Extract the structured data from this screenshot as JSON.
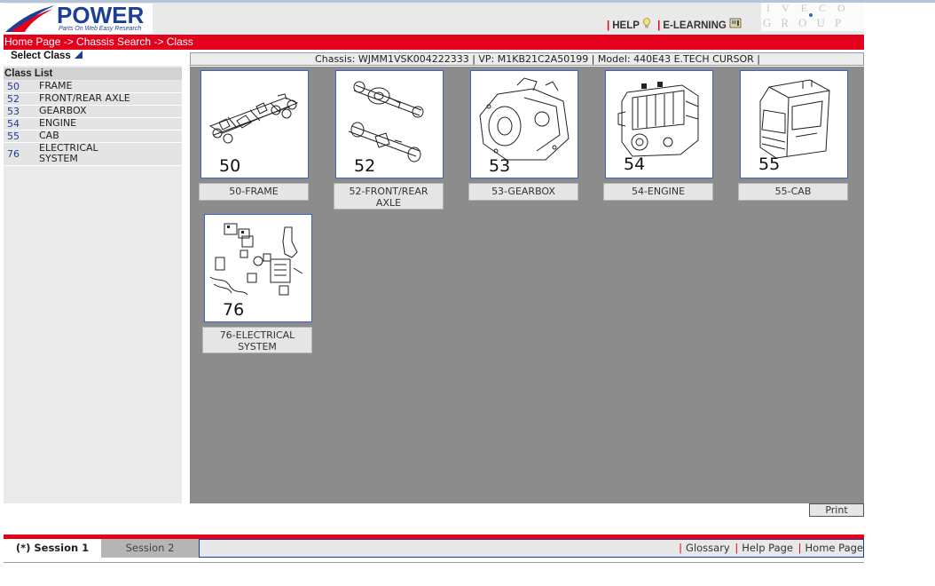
{
  "header": {
    "logo_title": "POWER",
    "logo_subtitle": "Parts On Web Easy Research",
    "help_label": "HELP",
    "elearning_label": "E-LEARNING",
    "brand_top": "IVECO",
    "brand_bottom": "GROUP"
  },
  "breadcrumb": {
    "items": [
      "Home Page",
      "Chassis Search",
      "Class"
    ],
    "separator": " -> "
  },
  "sidebar": {
    "select_label": "Select Class",
    "list_title": "Class List",
    "items": [
      {
        "code": "50",
        "name": "FRAME"
      },
      {
        "code": "52",
        "name": "FRONT/REAR AXLE"
      },
      {
        "code": "53",
        "name": "GEARBOX"
      },
      {
        "code": "54",
        "name": "ENGINE"
      },
      {
        "code": "55",
        "name": "CAB"
      },
      {
        "code": "76",
        "name": "ELECTRICAL SYSTEM"
      }
    ]
  },
  "chassis_info": "Chassis: WJMM1VSK004222333 | VP: M1KB21C2A50199 | Model: 440E43 E.TECH CURSOR |",
  "tiles": [
    {
      "number": "50",
      "caption": "50-FRAME",
      "icon": "frame-diagram-icon"
    },
    {
      "number": "52",
      "caption": "52-FRONT/REAR AXLE",
      "icon": "axle-diagram-icon"
    },
    {
      "number": "53",
      "caption": "53-GEARBOX",
      "icon": "gearbox-diagram-icon"
    },
    {
      "number": "54",
      "caption": "54-ENGINE",
      "icon": "engine-diagram-icon"
    },
    {
      "number": "55",
      "caption": "55-CAB",
      "icon": "cab-diagram-icon"
    },
    {
      "number": "76",
      "caption": "76-ELECTRICAL SYSTEM",
      "icon": "electrical-diagram-icon"
    }
  ],
  "print_label": "Print",
  "footer": {
    "tab_active": "(*) Session 1",
    "tab_inactive": "Session 2",
    "links": [
      "Glossary",
      "Help Page",
      "Home Page"
    ]
  },
  "colors": {
    "accent_red": "#e3001b",
    "brand_blue": "#1c3f94",
    "main_bg": "#8c8c8c"
  }
}
